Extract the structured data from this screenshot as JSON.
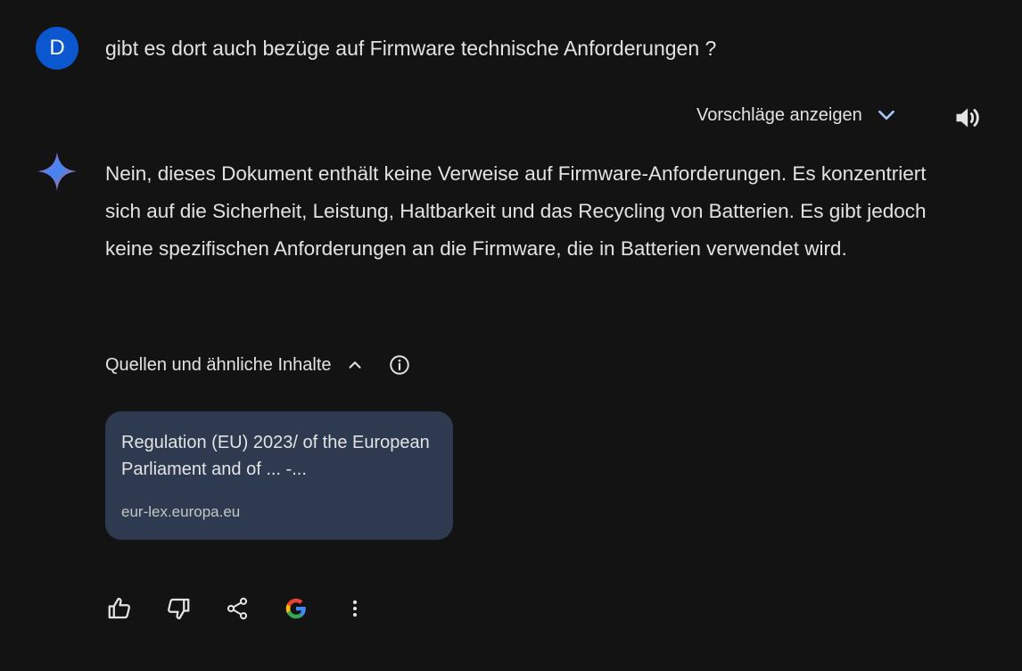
{
  "user": {
    "avatar_letter": "D",
    "query": "gibt es dort auch bezüge auf Firmware technische Anforderungen ?"
  },
  "controls": {
    "suggestions_label": "Vorschläge anzeigen"
  },
  "response": {
    "text": "Nein, dieses Dokument enthält keine Verweise auf Firmware-Anforderungen. Es konzentriert sich auf die Sicherheit, Leistung, Haltbarkeit und das Recycling von Batterien. Es gibt jedoch keine spezifischen Anforderungen an die Firmware, die in Batterien verwendet wird."
  },
  "sources": {
    "header": "Quellen und ähnliche Inhalte",
    "items": [
      {
        "title": "Regulation (EU) 2023/ of the European Parliament and of ... -...",
        "domain": "eur-lex.europa.eu"
      }
    ]
  },
  "actions": [
    {
      "icon": "thumbs-up-icon"
    },
    {
      "icon": "thumbs-down-icon"
    },
    {
      "icon": "share-icon"
    },
    {
      "icon": "google-icon"
    },
    {
      "icon": "more-vert-icon"
    }
  ],
  "colors": {
    "background": "#131314",
    "text": "#e3e3e3",
    "avatar": "#0b57d0",
    "card": "#2d3a4f",
    "chevron": "#a8c7fa"
  }
}
